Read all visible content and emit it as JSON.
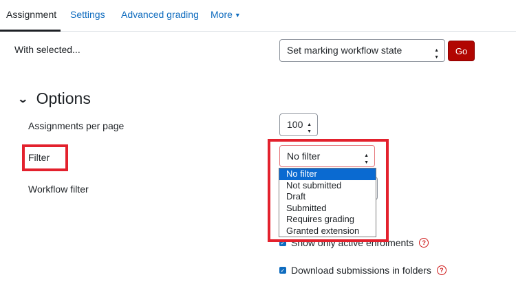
{
  "tabs": [
    {
      "label": "Assignment",
      "active": true
    },
    {
      "label": "Settings"
    },
    {
      "label": "Advanced grading"
    },
    {
      "label": "More"
    }
  ],
  "bulk": {
    "label": "With selected...",
    "select_value": "Set marking workflow state",
    "go_label": "Go"
  },
  "options": {
    "title": "Options",
    "per_page_label": "Assignments per page",
    "per_page_value": "100",
    "filter_label": "Filter",
    "filter_value": "No filter",
    "workflow_label": "Workflow filter",
    "filter_options": [
      "No filter",
      "Not submitted",
      "Draft",
      "Submitted",
      "Requires grading",
      "Granted extension"
    ],
    "selected_option": "No filter",
    "checkbox_active": "Show only active enrolments",
    "checkbox_download": "Download submissions in folders"
  },
  "colors": {
    "accent": "#0f6cbf",
    "go_button": "#b10602",
    "highlight": "#e3212d",
    "selected_option_bg": "#0a6ad1"
  },
  "icons": {
    "more": "chevron-down-icon",
    "options": "chevron-down-icon",
    "select": "updown-arrows-icon",
    "help": "question-circle-icon",
    "checkbox": "checkmark-icon"
  }
}
